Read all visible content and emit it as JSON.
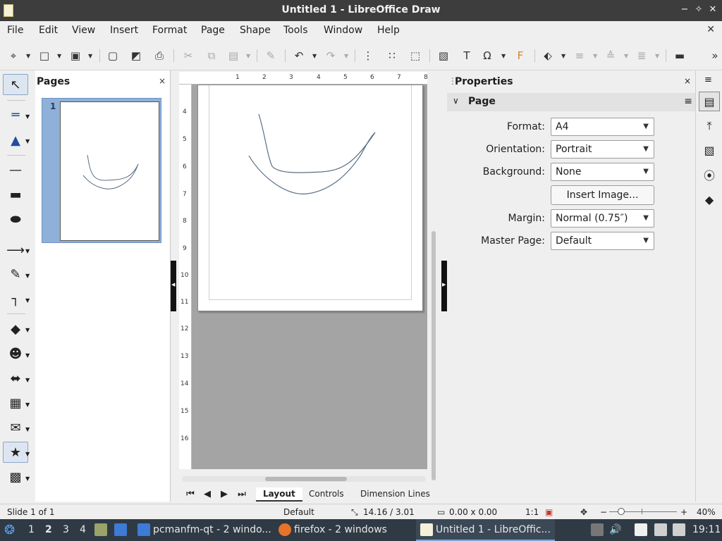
{
  "window": {
    "title": "Untitled 1 - LibreOffice Draw",
    "minimize": "−",
    "maximize": "✧",
    "close": "✕"
  },
  "menubar": {
    "items": [
      "File",
      "Edit",
      "View",
      "Insert",
      "Format",
      "Page",
      "Shape",
      "Tools",
      "Window",
      "Help"
    ],
    "doc_close": "✕"
  },
  "toolbar": {
    "icons": {
      "new": "⌖",
      "open": "□",
      "save": "▣",
      "export": "▢",
      "export_pdf": "◩",
      "print": "⎙",
      "cut": "✂",
      "copy": "⧉",
      "paste": "▤",
      "clone": "✎",
      "undo": "↶",
      "redo": "↷",
      "grid": "⋮",
      "helplines": "∷",
      "zoom": "⬚",
      "image": "▧",
      "textbox": "T",
      "special_char": "Ω",
      "fontwork": "F",
      "transform": "⬖",
      "align": "≡",
      "arrange": "≙",
      "distribute": "≣",
      "shadow": "▬",
      "more": "»"
    }
  },
  "left_tools": {
    "select": "↖",
    "line_color": "═",
    "fill_color": "▲",
    "line": "—",
    "rect": "▬",
    "ellipse": "⬬",
    "lines_arrows": "⟶",
    "curve": "✎",
    "connector": "┐",
    "basic_shapes": "◆",
    "symbol_shapes": "☻",
    "block_arrows": "⬌",
    "flowchart": "▦",
    "callouts": "✉",
    "stars": "★",
    "3d_objects": "▩"
  },
  "pages_pane": {
    "title": "Pages",
    "close": "×",
    "thumbnail_number": "1"
  },
  "ruler": {
    "h_ticks": [
      "1",
      "2",
      "3",
      "4",
      "5",
      "6",
      "7",
      "8"
    ],
    "v_ticks": [
      "4",
      "5",
      "6",
      "7",
      "8",
      "9",
      "10",
      "11",
      "12",
      "13",
      "14",
      "15",
      "16"
    ]
  },
  "bottom_tabs": {
    "nav_first": "⏮",
    "nav_prev": "◀",
    "nav_next": "▶",
    "nav_last": "⏭",
    "tabs": [
      "Layout",
      "Controls",
      "Dimension Lines"
    ],
    "active": "Layout"
  },
  "properties": {
    "title": "Properties",
    "close": "×",
    "section": "Page",
    "section_menu": "≡",
    "format_label": "Format:",
    "format_value": "A4",
    "orientation_label": "Orientation:",
    "orientation_value": "Portrait",
    "background_label": "Background:",
    "background_value": "None",
    "insert_image": "Insert Image...",
    "margin_label": "Margin:",
    "margin_value": "Normal (0.75″)",
    "master_label": "Master Page:",
    "master_value": "Default"
  },
  "deck": {
    "menu": "≡",
    "properties": "▤",
    "styles": "⤒",
    "gallery": "▧",
    "navigator": "⦿",
    "shapes": "◆"
  },
  "statusbar": {
    "slide": "Slide 1 of 1",
    "master": "Default",
    "position": "14.16 / 3.01",
    "size": "0.00 x 0.00",
    "scale": "1:1",
    "zoom": "40%",
    "zoom_minus": "−",
    "zoom_plus": "+"
  },
  "taskbar": {
    "workspaces": [
      "1",
      "2",
      "3",
      "4"
    ],
    "active_workspace": "2",
    "tasks": [
      "pcmanfm-qt - 2 windo...",
      "firefox - 2 windows",
      "Untitled 1 - LibreOffic..."
    ],
    "clock": "19:11"
  },
  "colors": {
    "accent": "#7aa7d8",
    "stroke": "#5a6e82",
    "titlebar": "#3d3d3d",
    "taskbar": "#2f3a45",
    "thumb_selected": "#8fb0d8"
  }
}
